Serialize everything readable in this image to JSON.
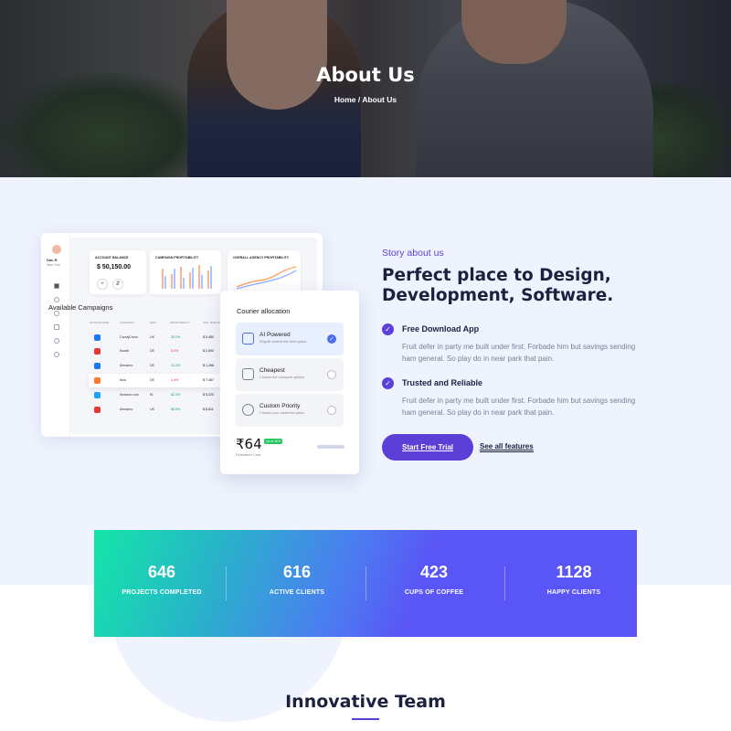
{
  "hero": {
    "title": "About Us",
    "breadcrumb": {
      "home": "Home",
      "separator": " / ",
      "current": "About Us"
    }
  },
  "dashboard": {
    "user_name": "Dan R",
    "user_location": "New York",
    "account_balance_label": "ACCOUNT BALANCE",
    "account_balance": "$ 50,150.00",
    "campaign_label": "CAMPAIGN PROFITABILITY",
    "agency_label": "OVERALL AGENCY PROFITABILITY",
    "campaigns_title": "Available Campaigns",
    "columns": [
      "AD PLATFORM",
      "CAMPAIGN",
      "GEO",
      "PROFITABILITY",
      "AVG. MARGIN"
    ],
    "rows": [
      {
        "name": "CandyCrush",
        "geo": "UK",
        "profit": "35.2%",
        "value": "$ 5,480",
        "color": "#1877f2",
        "trend": "up"
      },
      {
        "name": "Kazak",
        "geo": "DE",
        "profit": "5.0%",
        "value": "$ 2,592",
        "color": "#e53935",
        "trend": "down"
      },
      {
        "name": "Ahmamo",
        "geo": "DE",
        "profit": "31.3%",
        "value": "$ 1,268",
        "color": "#1877f2",
        "trend": "up"
      },
      {
        "name": "Ikea",
        "geo": "DE",
        "profit": "4.4%",
        "value": "$ 7,467",
        "color": "#ff7a2f",
        "trend": "down"
      },
      {
        "name": "Amazon.com",
        "geo": "EL",
        "profit": "82.3%",
        "value": "$ 5,220",
        "color": "#1da1f2",
        "trend": "up"
      },
      {
        "name": "Ahmamo",
        "geo": "UK",
        "profit": "68.5%",
        "value": "$ 8,811",
        "color": "#e53935",
        "trend": "up"
      }
    ]
  },
  "courier": {
    "title": "Courier allocation",
    "options": [
      {
        "name": "AI Powered",
        "desc": "Shypite selects the best option",
        "selected": true
      },
      {
        "name": "Cheapest",
        "desc": "Choose the cheapest options",
        "selected": false
      },
      {
        "name": "Custom Priority",
        "desc": "Choose your preferred option",
        "selected": false
      }
    ],
    "price": "₹64",
    "badge": "Up to 30%",
    "price_label": "Estimated Cost"
  },
  "about": {
    "kicker": "Story about us",
    "headline": "Perfect place to Design, Development, Software.",
    "features": [
      {
        "title": "Free Download App",
        "desc": "Fruit defer in party me built under first. Forbade him but savings sending ham general. So play do in near park that pain."
      },
      {
        "title": "Trusted and Reliable",
        "desc": "Fruit defer in party me built under first. Forbade him but savings sending ham general. So play do in near park that pain."
      }
    ],
    "cta_label": "Start Free Trial",
    "link_label": "See all features"
  },
  "stats": [
    {
      "value": "646",
      "label": "PROJECTS COMPLETED"
    },
    {
      "value": "616",
      "label": "ACTIVE CLIENTS"
    },
    {
      "value": "423",
      "label": "CUPS OF COFFEE"
    },
    {
      "value": "1128",
      "label": "HAPPY CLIENTS"
    }
  ],
  "team": {
    "title": "Innovative Team"
  },
  "colors": {
    "accent": "#5b3fd6",
    "stats_start": "#14e6a8",
    "stats_end": "#5a55f6",
    "selected": "#4d6df0"
  }
}
